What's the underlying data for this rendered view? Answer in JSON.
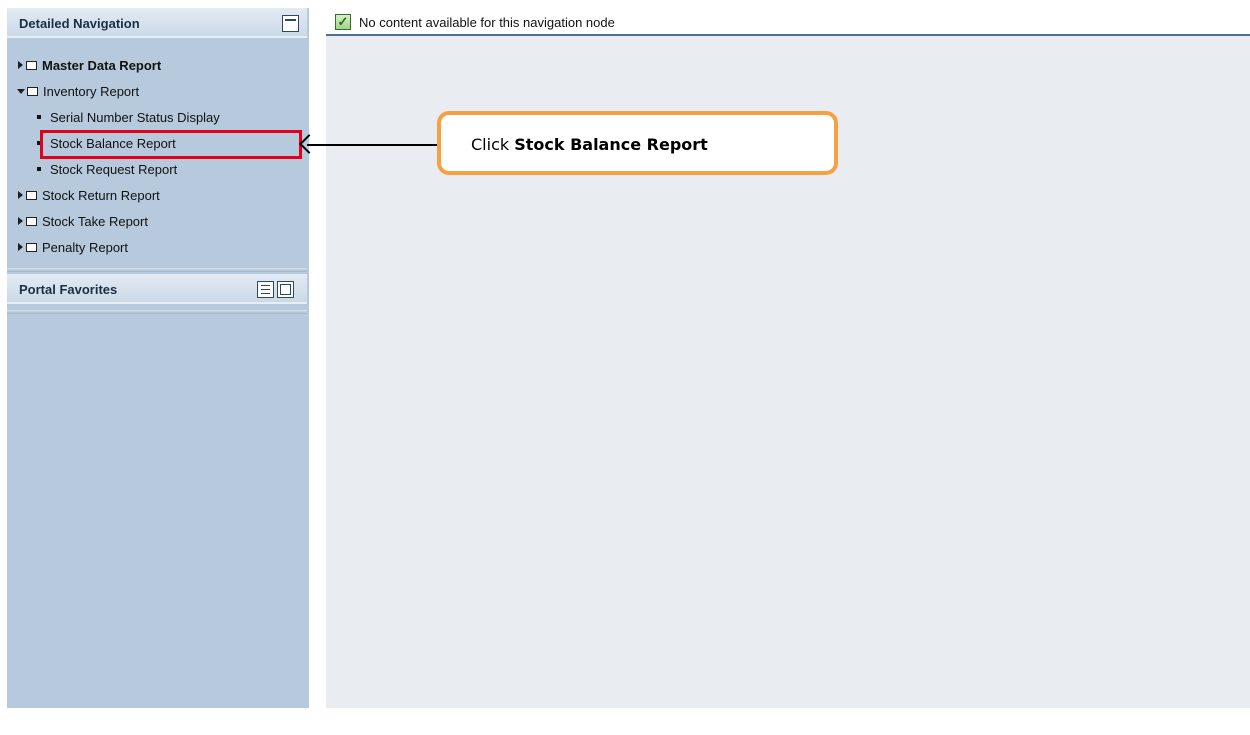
{
  "sidebar": {
    "detailed_navigation_title": "Detailed Navigation",
    "portal_favorites_title": "Portal Favorites",
    "tree": [
      {
        "label": "Master Data Report",
        "kind": "folder",
        "expanded": false,
        "bold": true
      },
      {
        "label": "Inventory Report",
        "kind": "folder",
        "expanded": true,
        "bold": false
      },
      {
        "label": "Serial Number Status Display",
        "kind": "leaf"
      },
      {
        "label": "Stock Balance Report",
        "kind": "leaf"
      },
      {
        "label": "Stock Request Report",
        "kind": "leaf"
      },
      {
        "label": "Stock Return Report",
        "kind": "folder",
        "expanded": false
      },
      {
        "label": "Stock Take Report",
        "kind": "folder",
        "expanded": false
      },
      {
        "label": "Penalty Report",
        "kind": "folder",
        "expanded": false
      }
    ]
  },
  "content": {
    "message": "No content available for this navigation node"
  },
  "annotation": {
    "callout_prefix": "Click ",
    "callout_bold": "Stock Balance Report"
  },
  "colors": {
    "sidebar_bg": "#b7c9dc",
    "highlight": "#e3001b",
    "callout_border": "#f5a143"
  }
}
